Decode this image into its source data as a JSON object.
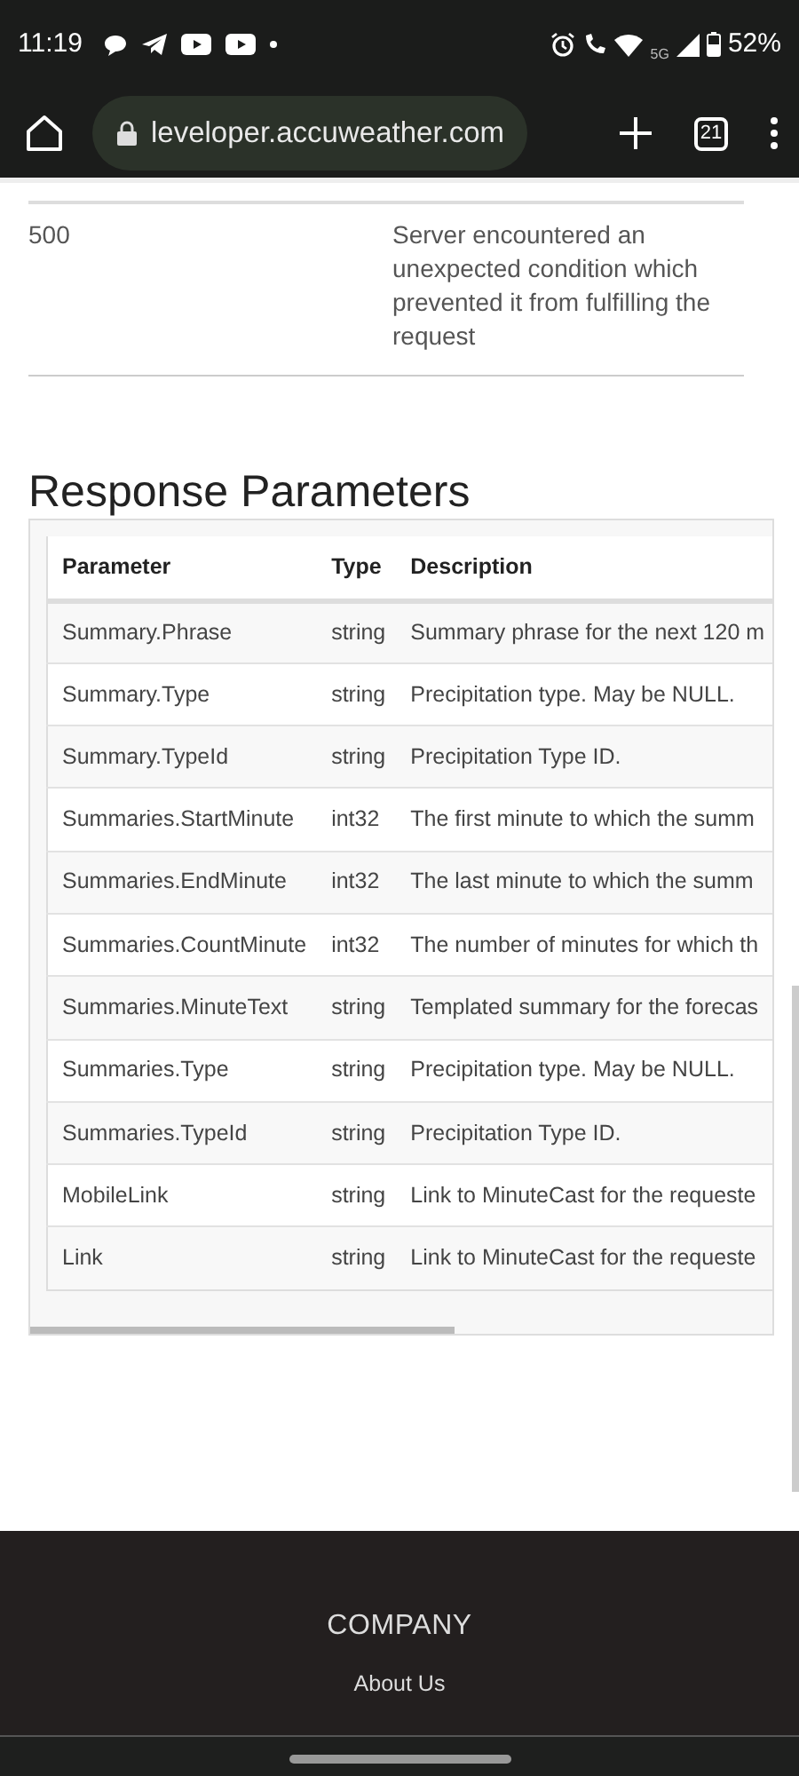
{
  "status_bar": {
    "time": "11:19",
    "network": "5G",
    "battery": "52%"
  },
  "browser": {
    "url": "leveloper.accuweather.com",
    "tab_count": "21"
  },
  "error_table": {
    "rows": [
      {
        "code": "500",
        "description": "Server encountered an unexpected condition which prevented it from fulfilling the request"
      }
    ]
  },
  "section_title": "Response Parameters",
  "parameters_table": {
    "columns": [
      "Parameter",
      "Type",
      "Description"
    ],
    "rows": [
      [
        "Summary.Phrase",
        "string",
        "Summary phrase for the next 120 m"
      ],
      [
        "Summary.Type",
        "string",
        "Precipitation type. May be NULL."
      ],
      [
        "Summary.TypeId",
        "string",
        "Precipitation Type ID."
      ],
      [
        "Summaries.StartMinute",
        "int32",
        "The first minute to which the summ"
      ],
      [
        "Summaries.EndMinute",
        "int32",
        "The last minute to which the summ"
      ],
      [
        "Summaries.CountMinute",
        "int32",
        "The number of minutes for which th"
      ],
      [
        "Summaries.MinuteText",
        "string",
        "Templated summary for the forecas"
      ],
      [
        "Summaries.Type",
        "string",
        "Precipitation type. May be NULL."
      ],
      [
        "Summaries.TypeId",
        "string",
        "Precipitation Type ID."
      ],
      [
        "MobileLink",
        "string",
        "Link to MinuteCast for the requeste"
      ],
      [
        "Link",
        "string",
        "Link to MinuteCast for the requeste"
      ]
    ]
  },
  "footer": {
    "heading": "COMPANY",
    "links": [
      "About Us"
    ]
  }
}
